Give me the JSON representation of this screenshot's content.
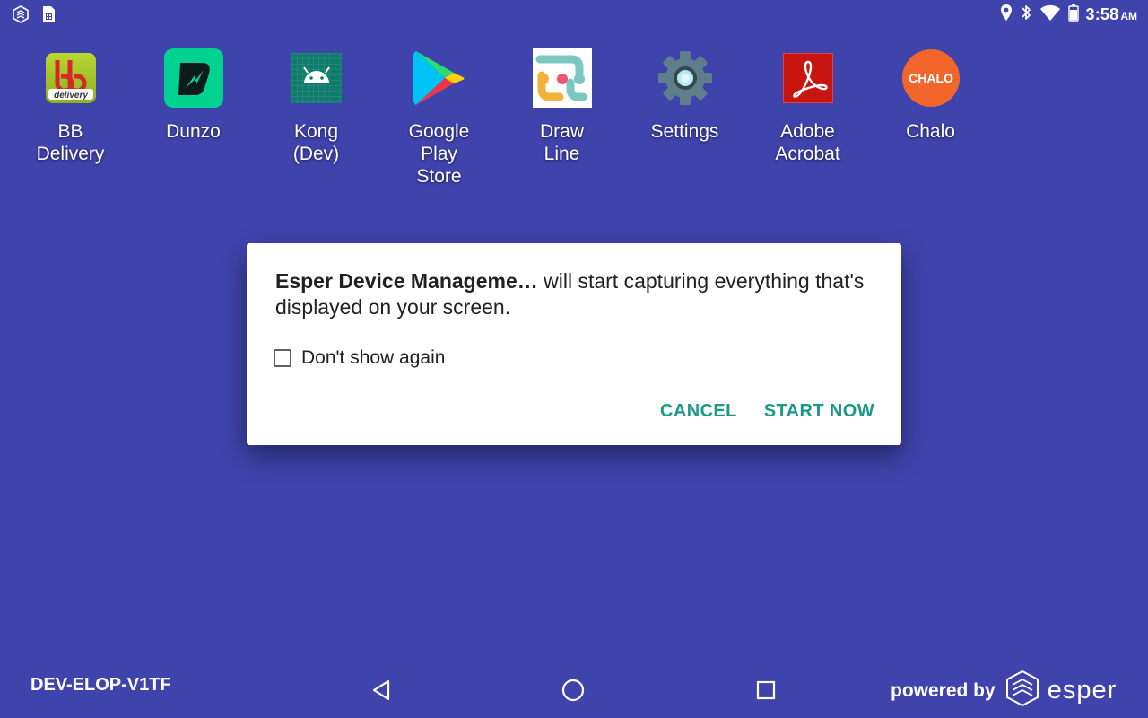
{
  "status_bar": {
    "time": "3:58",
    "ampm": "AM",
    "left_icons": [
      "esper-logo-icon",
      "sim-card-icon"
    ],
    "right_icons": [
      "location-icon",
      "bluetooth-icon",
      "wifi-icon",
      "battery-icon"
    ]
  },
  "apps": [
    {
      "label": "BB\nDelivery",
      "icon": "bb-delivery-icon"
    },
    {
      "label": "Dunzo",
      "icon": "dunzo-icon"
    },
    {
      "label": "Kong\n(Dev)",
      "icon": "android-icon"
    },
    {
      "label": "Google\nPlay\nStore",
      "icon": "play-store-icon"
    },
    {
      "label": "Draw\nLine",
      "icon": "draw-line-icon"
    },
    {
      "label": "Settings",
      "icon": "settings-gear-icon"
    },
    {
      "label": "Adobe\nAcrobat",
      "icon": "adobe-acrobat-icon"
    },
    {
      "label": "Chalo",
      "icon": "chalo-icon"
    }
  ],
  "bb_logo_text": "delivery",
  "chalo_logo_text": "CHALO",
  "dialog": {
    "app_name": "Esper Device Manageme…",
    "message": " will start capturing everything that's displayed on your screen.",
    "checkbox_label": "Don't show again",
    "checkbox_checked": false,
    "cancel_label": "CANCEL",
    "start_label": "START NOW",
    "accent_color": "#1a9985"
  },
  "bottom_bar": {
    "device_id": "DEV-ELOP-V1TF",
    "powered_by": "powered by",
    "brand": "esper",
    "nav": [
      "back-icon",
      "home-icon",
      "recents-icon"
    ]
  },
  "colors": {
    "background": "#3f44ad"
  }
}
